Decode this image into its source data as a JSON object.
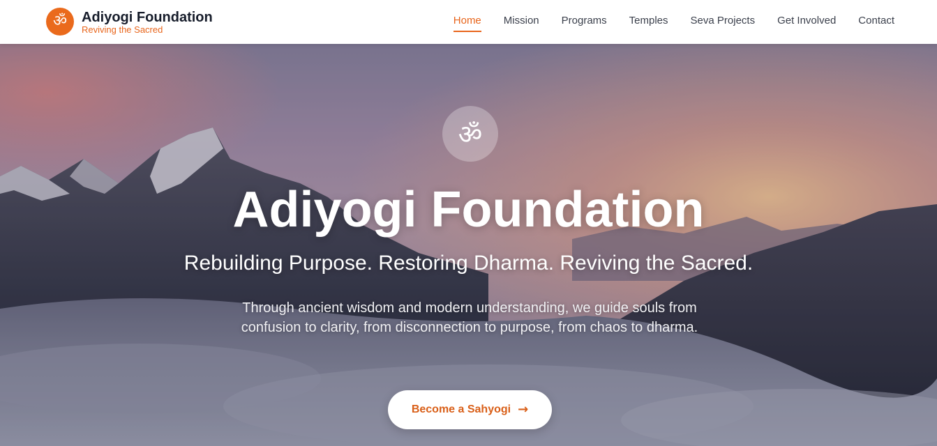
{
  "header": {
    "brand_title": "Adiyogi Foundation",
    "brand_subtitle": "Reviving the Sacred",
    "logo_glyph": "ॐ",
    "nav": [
      {
        "label": "Home",
        "active": true
      },
      {
        "label": "Mission"
      },
      {
        "label": "Programs"
      },
      {
        "label": "Temples"
      },
      {
        "label": "Seva Projects"
      },
      {
        "label": "Get Involved"
      },
      {
        "label": "Contact"
      }
    ]
  },
  "hero": {
    "om_glyph": "ॐ",
    "title": "Adiyogi Foundation",
    "tagline": "Rebuilding Purpose. Restoring Dharma. Reviving the Sacred.",
    "description": "Through ancient wisdom and modern understanding, we guide souls from confusion to clarity, from disconnection to purpose, from chaos to dharma.",
    "cta_label": "Become a Sahyogi",
    "cta_arrow": "→",
    "background_image": "mountain-sunrise-photo"
  },
  "colors": {
    "accent": "#e8651b",
    "nav_text": "#3a3f4b",
    "brand_title": "#161c2a"
  }
}
